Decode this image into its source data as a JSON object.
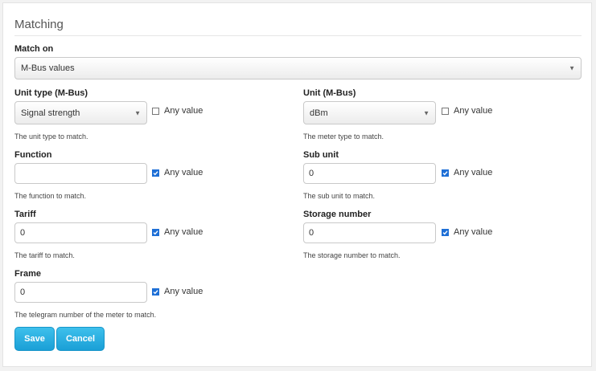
{
  "section": {
    "title": "Matching"
  },
  "match_on": {
    "label": "Match on",
    "value": "M-Bus values"
  },
  "unit_type": {
    "label": "Unit type (M-Bus)",
    "value": "Signal strength",
    "any_label": "Any value",
    "any_checked": false,
    "help": "The unit type to match."
  },
  "unit": {
    "label": "Unit (M-Bus)",
    "value": "dBm",
    "any_label": "Any value",
    "any_checked": false,
    "help": "The meter type to match."
  },
  "function": {
    "label": "Function",
    "value": "",
    "any_label": "Any value",
    "any_checked": true,
    "help": "The function to match."
  },
  "sub_unit": {
    "label": "Sub unit",
    "value": "0",
    "any_label": "Any value",
    "any_checked": true,
    "help": "The sub unit to match."
  },
  "tariff": {
    "label": "Tariff",
    "value": "0",
    "any_label": "Any value",
    "any_checked": true,
    "help": "The tariff to match."
  },
  "storage_number": {
    "label": "Storage number",
    "value": "0",
    "any_label": "Any value",
    "any_checked": true,
    "help": "The storage number to match."
  },
  "frame": {
    "label": "Frame",
    "value": "0",
    "any_label": "Any value",
    "any_checked": true,
    "help": "The telegram number of the meter to match."
  },
  "buttons": {
    "save": "Save",
    "cancel": "Cancel"
  },
  "icons": {
    "dropdown": "chevron-down-icon",
    "checkmark": "check-icon"
  },
  "colors": {
    "button": "#1a9fd6",
    "checkbox_checked": "#1e6fd6"
  }
}
